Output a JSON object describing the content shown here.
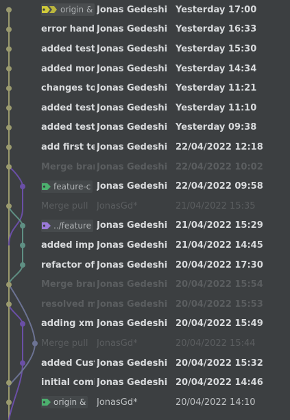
{
  "commits": [
    {
      "message": "origin &",
      "author": "Jonas Gedeshi",
      "date": "Yesterday 17:00",
      "style": "normal",
      "tag": "yellow"
    },
    {
      "message": "error handling",
      "author": "Jonas Gedeshi",
      "date": "Yesterday 16:33",
      "style": "normal"
    },
    {
      "message": "added tests",
      "author": "Jonas Gedeshi",
      "date": "Yesterday 15:30",
      "style": "normal"
    },
    {
      "message": "added more",
      "author": "Jonas Gedeshi",
      "date": "Yesterday 14:34",
      "style": "normal"
    },
    {
      "message": "changes to",
      "author": "Jonas Gedeshi",
      "date": "Yesterday 11:21",
      "style": "normal"
    },
    {
      "message": "added tests",
      "author": "Jonas Gedeshi",
      "date": "Yesterday 11:10",
      "style": "normal"
    },
    {
      "message": "added tests",
      "author": "Jonas Gedeshi",
      "date": "Yesterday 09:38",
      "style": "normal"
    },
    {
      "message": "add first te",
      "author": "Jonas Gedeshi",
      "date": "22/04/2022 12:18",
      "style": "normal"
    },
    {
      "message": "Merge bran",
      "author": "Jonas Gedeshi",
      "date": "22/04/2022 10:02",
      "style": "dim"
    },
    {
      "message": "feature-c",
      "author": "Jonas Gedeshi",
      "date": "22/04/2022 09:58",
      "style": "normal",
      "tag": "green"
    },
    {
      "message": "Merge pull",
      "author": "JonasGd*",
      "date": "21/04/2022 15:35",
      "style": "faint"
    },
    {
      "message": "../feature",
      "author": "Jonas Gedeshi",
      "date": "21/04/2022 15:29",
      "style": "normal",
      "tag": "purple"
    },
    {
      "message": "added impl",
      "author": "Jonas Gedeshi",
      "date": "21/04/2022 14:45",
      "style": "normal"
    },
    {
      "message": "refactor of",
      "author": "Jonas Gedeshi",
      "date": "20/04/2022 17:30",
      "style": "normal"
    },
    {
      "message": "Merge bran",
      "author": "Jonas Gedeshi",
      "date": "20/04/2022 15:54",
      "style": "dim"
    },
    {
      "message": "resolved m",
      "author": "Jonas Gedeshi",
      "date": "20/04/2022 15:53",
      "style": "dim"
    },
    {
      "message": "adding xml",
      "author": "Jonas Gedeshi",
      "date": "20/04/2022 15:49",
      "style": "normal"
    },
    {
      "message": "Merge pull",
      "author": "JonasGd*",
      "date": "20/04/2022 15:44",
      "style": "faint"
    },
    {
      "message": "added Cust",
      "author": "Jonas Gedeshi",
      "date": "20/04/2022 15:32",
      "style": "normal"
    },
    {
      "message": "initial comi",
      "author": "Jonas Gedeshi",
      "date": "20/04/2022 14:46",
      "style": "normal"
    },
    {
      "message": "origin &",
      "author": "JonasGd*",
      "date": "20/04/2022 14:10",
      "style": "plain",
      "tag": "green"
    }
  ],
  "colors": {
    "branch_main": "#9a9a6e",
    "branch_purple": "#6a4fa6",
    "branch_teal": "#5f8f83",
    "branch_blue": "#6c7393",
    "tag_yellow": "#cfc93a",
    "tag_green": "#4cb06e",
    "tag_purple": "#9b7ad8"
  }
}
